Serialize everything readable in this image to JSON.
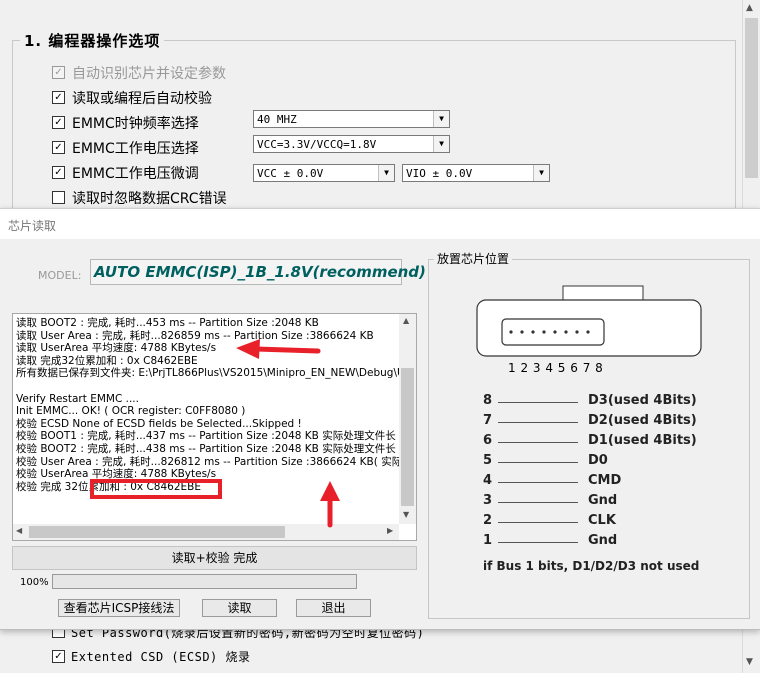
{
  "background": {
    "section_title": "1. 编程器操作选项",
    "options": [
      {
        "label": "自动识别芯片并设定参数",
        "checked": true,
        "disabled": true
      },
      {
        "label": "读取或编程后自动校验",
        "checked": true,
        "disabled": false
      },
      {
        "label": "EMMC时钟频率选择",
        "checked": true,
        "disabled": false
      },
      {
        "label": "EMMC工作电压选择",
        "checked": true,
        "disabled": false
      },
      {
        "label": "EMMC工作电压微调",
        "checked": true,
        "disabled": false
      },
      {
        "label": "读取时忽略数据CRC错误",
        "checked": false,
        "disabled": false
      }
    ],
    "clock_select": "40 MHZ",
    "voltage_select": "VCC=3.3V/VCCQ=1.8V",
    "vcc_trim_select": "VCC ± 0.0V",
    "vio_trim_select": "VIO ± 0.0V",
    "bottom_options": [
      {
        "label": "Set Password(烧录后设置新的密码,新密码为空时复位密码)",
        "checked": false
      },
      {
        "label": "Extented CSD (ECSD) 烧录",
        "checked": true
      }
    ]
  },
  "dialog": {
    "title": "芯片读取",
    "model_label": "MODEL:",
    "model_value": "AUTO EMMC(ISP)_1B_1.8V(recommend)",
    "log_lines": [
      "读取 BOOT2 : 完成, 耗时...453 ms -- Partition Size :2048 KB",
      "读取 User Area : 完成, 耗时...826859 ms --  Partition Size :3866624 KB",
      "读取 UserArea 平均速度: 4788 KBytes/s",
      "读取 完成32位累加和 : 0x C8462EBE",
      "所有数据已保存到文件夹: E:\\PrjTL866Plus\\VS2015\\Minipro_EN_NEW\\Debug\\U",
      "",
      "Verify Restart EMMC ....",
      "Init EMMC... OK!   ( OCR register: C0FF8080 )",
      "校验 ECSD None of ECSD fields be Selected...Skipped !",
      "校验 BOOT1 : 完成, 耗时...437 ms -- Partition Size :2048 KB 实际处理文件长",
      "校验 BOOT2 : 完成, 耗时...438 ms -- Partition Size :2048 KB 实际处理文件长",
      "校验 User Area : 完成, 耗时...826812 ms -- Partition Size :3866624 KB( 实际处",
      "校验 UserArea 平均速度: 4788 KBytes/s",
      "校验 完成 32位累加和 : 0x C8462EBE"
    ],
    "status_text": "读取+校验 完成",
    "progress_text": "100%",
    "progress_value": 1.0,
    "buttons": {
      "icsp": "查看芯片ICSP接线法",
      "read": "读取",
      "exit": "退出"
    },
    "chip_group": {
      "title": "放置芯片位置",
      "pin_numbers": "1 2 3 4 5 6 7 8",
      "pins": [
        {
          "num": "8",
          "name": "D3(used 4Bits)"
        },
        {
          "num": "7",
          "name": "D2(used 4Bits)"
        },
        {
          "num": "6",
          "name": "D1(used 4Bits)"
        },
        {
          "num": "5",
          "name": "D0"
        },
        {
          "num": "4",
          "name": "CMD"
        },
        {
          "num": "3",
          "name": "Gnd"
        },
        {
          "num": "2",
          "name": "CLK"
        },
        {
          "num": "1",
          "name": "Gnd"
        }
      ],
      "bus_note": "if Bus  1 bits, D1/D2/D3 not used"
    }
  },
  "colors": {
    "annotation_red": "#e8202a",
    "model_text": "#006060"
  }
}
